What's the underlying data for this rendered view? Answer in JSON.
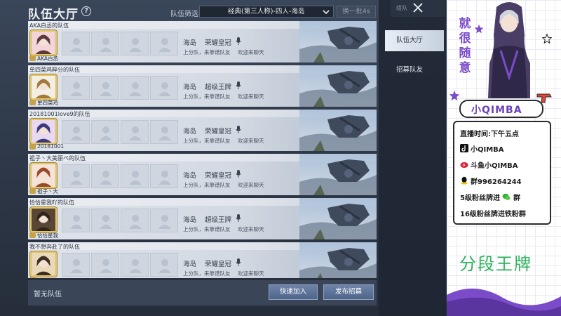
{
  "header": {
    "title": "队伍大厅",
    "filter_label": "队伍筛选",
    "filter_value": "经典(第三人称)-四人-海岛",
    "refresh_label": "换一批4s"
  },
  "teams": [
    {
      "title": "AKA白丞的队伍",
      "leader": "AKA白丞",
      "map": "海岛",
      "rank": "荣耀皇冠",
      "desc1": "上分队，来靠谱队友",
      "desc2": "欢迎来聊天"
    },
    {
      "title": "单四菜鸡粹分的队伍",
      "leader": "单四菜鸡",
      "map": "海岛",
      "rank": "超级王牌",
      "desc1": "上分队，来靠谱队友",
      "desc2": "欢迎来聊天"
    },
    {
      "title": "20181001love9的队伍",
      "leader": "20181001",
      "map": "海岛",
      "rank": "荣耀皇冠",
      "desc1": "上分队，来靠谱队友",
      "desc2": "欢迎来聊天"
    },
    {
      "title": "祖子丶大美丽ペ的队伍",
      "leader": "祖子丶大",
      "map": "海岛",
      "rank": "荣耀皇冠",
      "desc1": "上分队，来靠谱队友",
      "desc2": "欢迎来聊天"
    },
    {
      "title": "恰恰星我吖的队伍",
      "leader": "恰恰星我",
      "map": "海岛",
      "rank": "超级王牌",
      "desc1": "上分队，来靠谱队友",
      "desc2": "欢迎来聊天"
    },
    {
      "title": "我不想奔赴了的队伍",
      "leader": "",
      "map": "海岛",
      "rank": "荣耀皇冠",
      "desc1": "上分队，来靠谱队友",
      "desc2": "欢迎来聊天"
    }
  ],
  "footer": {
    "empty_text": "暂无队伍",
    "quick_join": "快速加入",
    "publish": "发布招募"
  },
  "side": {
    "header_label": "组队",
    "tabs": [
      "队伍大厅",
      "招募队友"
    ]
  },
  "overlay": {
    "vertical_text": "就很随意",
    "streamer_name": "小QIMBA",
    "schedule": "直播时间:下午五点",
    "douyin": "小QIMBA",
    "weibo": "斗鱼小QIMBA",
    "qq_group": "群996264244",
    "fan_group_5": "5级粉丝牌进",
    "fan_group_5_suffix": "群",
    "fan_group_16": "16级粉丝牌进铁粉群",
    "rank_text": "分段王牌"
  },
  "colors": {
    "accent_purple": "#7b4cc9",
    "rank_green": "#2bb35a",
    "button_blue": "#5a6f94"
  }
}
